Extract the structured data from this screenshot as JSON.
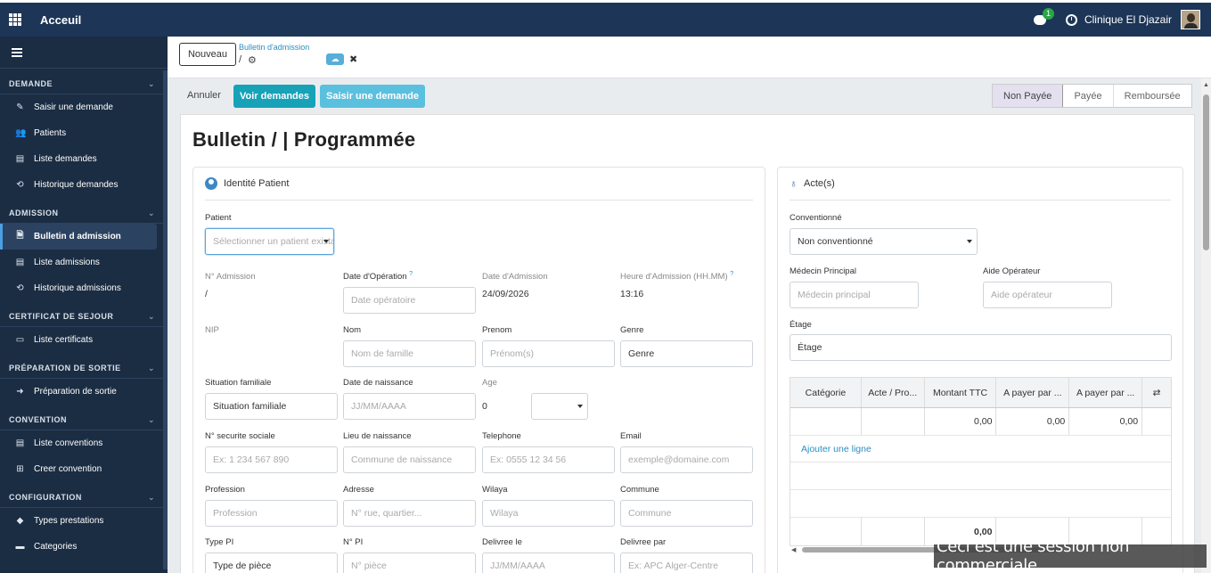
{
  "topbar": {
    "title": "Acceuil",
    "notif_count": "1",
    "company": "Clinique El Djazair"
  },
  "sidebar": {
    "sections": [
      {
        "title": "DEMANDE",
        "items": [
          {
            "icon": "✎",
            "label": "Saisir une demande"
          },
          {
            "icon": "👥",
            "label": "Patients"
          },
          {
            "icon": "▤",
            "label": "Liste demandes"
          },
          {
            "icon": "⟲",
            "label": "Historique demandes"
          }
        ]
      },
      {
        "title": "ADMISSION",
        "items": [
          {
            "icon": "🗎",
            "label": "Bulletin d admission"
          },
          {
            "icon": "▤",
            "label": "Liste admissions"
          },
          {
            "icon": "⟲",
            "label": "Historique admissions"
          }
        ]
      },
      {
        "title": "CERTIFICAT DE SEJOUR",
        "items": [
          {
            "icon": "▭",
            "label": "Liste certificats"
          }
        ]
      },
      {
        "title": "PRÉPARATION DE SORTIE",
        "items": [
          {
            "icon": "➜",
            "label": "Préparation de sortie"
          }
        ]
      },
      {
        "title": "CONVENTION",
        "items": [
          {
            "icon": "▤",
            "label": "Liste conventions"
          },
          {
            "icon": "⊞",
            "label": "Creer convention"
          }
        ]
      },
      {
        "title": "CONFIGURATION",
        "items": [
          {
            "icon": "◆",
            "label": "Types prestations"
          },
          {
            "icon": "▬",
            "label": "Categories"
          }
        ]
      }
    ],
    "active_item": "Bulletin d admission"
  },
  "breadcrumb": {
    "new_button": "Nouveau",
    "link": "Bulletin d'admission",
    "slash": "/"
  },
  "controls": {
    "cancel": "Annuler",
    "view_requests": "Voir demandes",
    "enter_request": "Saisir une demande",
    "statuses": [
      "Non Payée",
      "Payée",
      "Remboursée"
    ],
    "current_status": "Non Payée"
  },
  "sheet": {
    "title": "Bulletin / | Programmée"
  },
  "identity": {
    "header": "Identité Patient",
    "patient_label": "Patient",
    "patient_placeholder": "Sélectionner un patient existant",
    "admission_no_label": "N° Admission",
    "admission_no_value": "/",
    "operation_date_label": "Date d'Opération",
    "operation_date_placeholder": "Date opératoire",
    "admission_date_label": "Date d'Admission",
    "admission_date_value": "24/09/2026",
    "admission_time_label": "Heure d'Admission (HH.MM)",
    "admission_time_value": "13:16",
    "help_mark": "?",
    "nip_label": "NIP",
    "nom_label": "Nom",
    "nom_placeholder": "Nom de famille",
    "prenom_label": "Prenom",
    "prenom_placeholder": "Prénom(s)",
    "genre_label": "Genre",
    "genre_value": "Genre",
    "situation_label": "Situation familiale",
    "situation_value": "Situation familiale",
    "birth_date_label": "Date de naissance",
    "birth_date_placeholder": "JJ/MM/AAAA",
    "age_label": "Age",
    "age_value": "0",
    "secu_label": "N° securite sociale",
    "secu_placeholder": "Ex: 1 234 567 890",
    "birth_place_label": "Lieu de naissance",
    "birth_place_placeholder": "Commune de naissance",
    "phone_label": "Telephone",
    "phone_placeholder": "Ex: 0555 12 34 56",
    "email_label": "Email",
    "email_placeholder": "exemple@domaine.com",
    "profession_label": "Profession",
    "profession_placeholder": "Profession",
    "address_label": "Adresse",
    "address_placeholder": "N° rue, quartier...",
    "wilaya_label": "Wilaya",
    "wilaya_placeholder": "Wilaya",
    "commune_label": "Commune",
    "commune_placeholder": "Commune",
    "id_type_label": "Type PI",
    "id_type_value": "Type de pièce",
    "id_no_label": "N° PI",
    "id_no_placeholder": "N° pièce",
    "delivered_on_label": "Delivree le",
    "delivered_on_placeholder": "JJ/MM/AAAA",
    "delivered_by_label": "Delivree par",
    "delivered_by_placeholder": "Ex: APC Alger-Centre"
  },
  "acts": {
    "header": "Acte(s)",
    "conventionne_label": "Conventionné",
    "conventionne_value": "Non conventionné",
    "doctor_label": "Médecin Principal",
    "doctor_placeholder": "Médecin principal",
    "aide_label": "Aide Opérateur",
    "aide_placeholder": "Aide opérateur",
    "floor_label": "Étage",
    "floor_value": "Étage",
    "table": {
      "headers": [
        "Catégorie",
        "Acte / Pro...",
        "Montant TTC",
        "A payer par ...",
        "A payer par ..."
      ],
      "row": [
        "",
        "",
        "0,00",
        "0,00",
        "0,00"
      ],
      "add_line": "Ajouter une ligne",
      "total": "0,00"
    }
  },
  "watermark": "Ceci est une session non commerciale."
}
